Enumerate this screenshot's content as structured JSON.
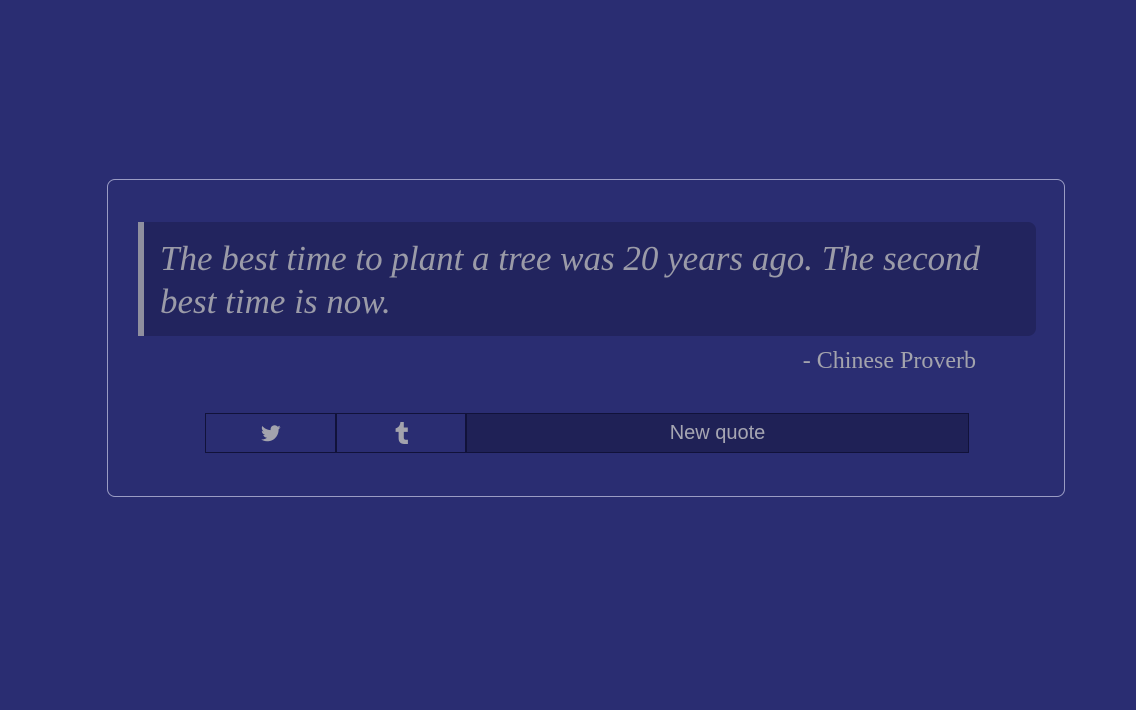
{
  "quote": {
    "text": "The best time to plant a tree was 20 years ago. The second best time is now.",
    "author": "- Chinese Proverb"
  },
  "buttons": {
    "twitter_icon": "twitter-icon",
    "tumblr_icon": "tumblr-icon",
    "new_quote_label": "New quote"
  },
  "colors": {
    "background": "#2a2d72",
    "quote_background": "#22245e",
    "text": "#9b9ba8"
  }
}
